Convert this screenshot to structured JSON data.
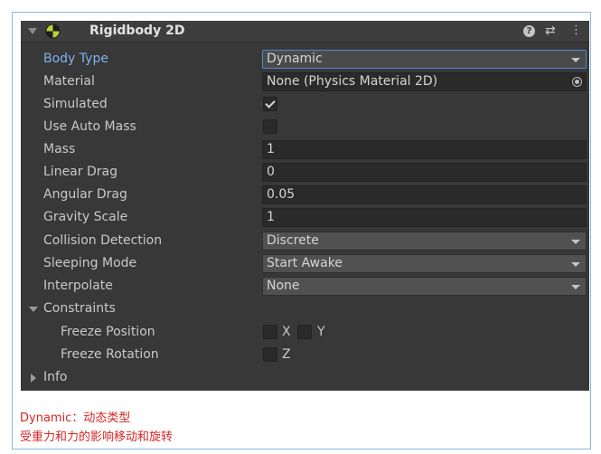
{
  "component": {
    "title": "Rigidbody 2D",
    "icon": "rigidbody2d-icon",
    "help_icon": "help-icon",
    "preset_icon": "preset-icon",
    "menu_icon": "kebab-menu-icon"
  },
  "fields": {
    "body_type": {
      "label": "Body Type",
      "value": "Dynamic"
    },
    "material": {
      "label": "Material",
      "value": "None (Physics Material 2D)"
    },
    "simulated": {
      "label": "Simulated",
      "checked": true
    },
    "use_auto_mass": {
      "label": "Use Auto Mass",
      "checked": false
    },
    "mass": {
      "label": "Mass",
      "value": "1"
    },
    "linear_drag": {
      "label": "Linear Drag",
      "value": "0"
    },
    "angular_drag": {
      "label": "Angular Drag",
      "value": "0.05"
    },
    "gravity_scale": {
      "label": "Gravity Scale",
      "value": "1"
    },
    "collision_detection": {
      "label": "Collision Detection",
      "value": "Discrete"
    },
    "sleeping_mode": {
      "label": "Sleeping Mode",
      "value": "Start Awake"
    },
    "interpolate": {
      "label": "Interpolate",
      "value": "None"
    }
  },
  "constraints": {
    "label": "Constraints",
    "freeze_position": {
      "label": "Freeze Position",
      "x": "X",
      "y": "Y"
    },
    "freeze_rotation": {
      "label": "Freeze Rotation",
      "z": "Z"
    }
  },
  "info": {
    "label": "Info"
  },
  "caption": {
    "line1": "Dynamic：动态类型",
    "line2": "受重力和力的影响移动和旋转"
  },
  "colors": {
    "panel_bg": "#383838",
    "label_highlight": "#7fb0ee",
    "caption_text": "#d62525",
    "frame_border": "#8fb8dc"
  }
}
